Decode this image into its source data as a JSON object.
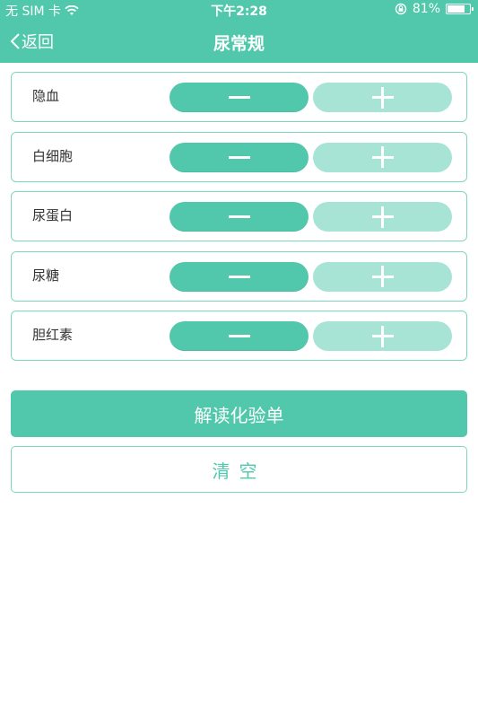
{
  "status_bar": {
    "carrier": "无 SIM 卡",
    "time": "下午2:28",
    "battery": "81%",
    "battery_level": 0.81
  },
  "nav": {
    "back_label": "返回",
    "title": "尿常规"
  },
  "items": [
    {
      "label": "隐血"
    },
    {
      "label": "白细胞"
    },
    {
      "label": "尿蛋白"
    },
    {
      "label": "尿糖"
    },
    {
      "label": "胆红素"
    }
  ],
  "actions": {
    "interpret_label": "解读化验单",
    "clear_label": "清空"
  },
  "colors": {
    "accent": "#51c8ab",
    "accent_light": "#a8e4d5",
    "border": "#7fd6bf"
  }
}
